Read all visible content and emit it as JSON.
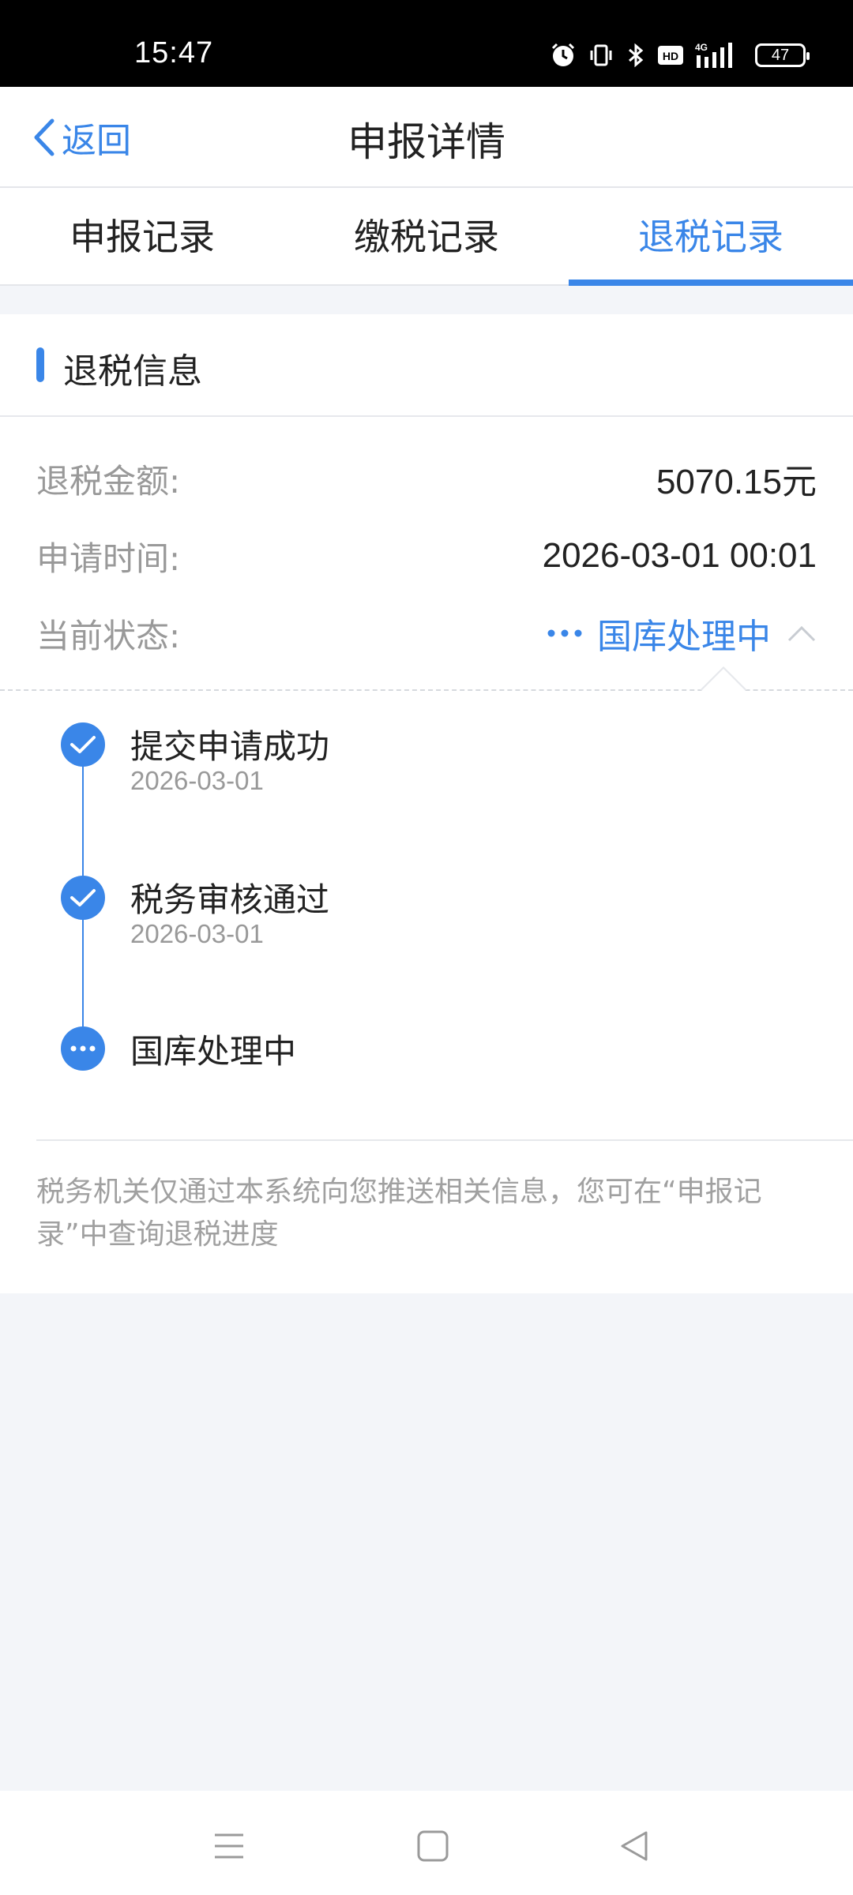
{
  "status_bar": {
    "time": "15:47",
    "battery": "47",
    "icons": [
      "alarm-icon",
      "vibrate-icon",
      "bluetooth-icon",
      "hd-icon",
      "signal-4g-icon",
      "battery-icon"
    ]
  },
  "header": {
    "back_label": "返回",
    "title": "申报详情"
  },
  "tabs": [
    {
      "label": "申报记录",
      "active": false
    },
    {
      "label": "缴税记录",
      "active": false
    },
    {
      "label": "退税记录",
      "active": true
    }
  ],
  "refund_info": {
    "section_title": "退税信息",
    "amount_label": "退税金额:",
    "amount_value": "5070.15元",
    "time_label": "申请时间:",
    "time_value": "2026-03-01 00:01",
    "status_label": "当前状态:",
    "status_value": "国库处理中"
  },
  "timeline": [
    {
      "title": "提交申请成功",
      "date": "2026-03-01",
      "state": "done"
    },
    {
      "title": "税务审核通过",
      "date": "2026-03-01",
      "state": "done"
    },
    {
      "title": "国库处理中",
      "date": "",
      "state": "processing"
    }
  ],
  "notice": "税务机关仅通过本系统向您推送相关信息，您可在“申报记录”中查询退税进度",
  "colors": {
    "accent": "#3a86e8",
    "background": "#f3f5f9",
    "muted_text": "#999999"
  }
}
